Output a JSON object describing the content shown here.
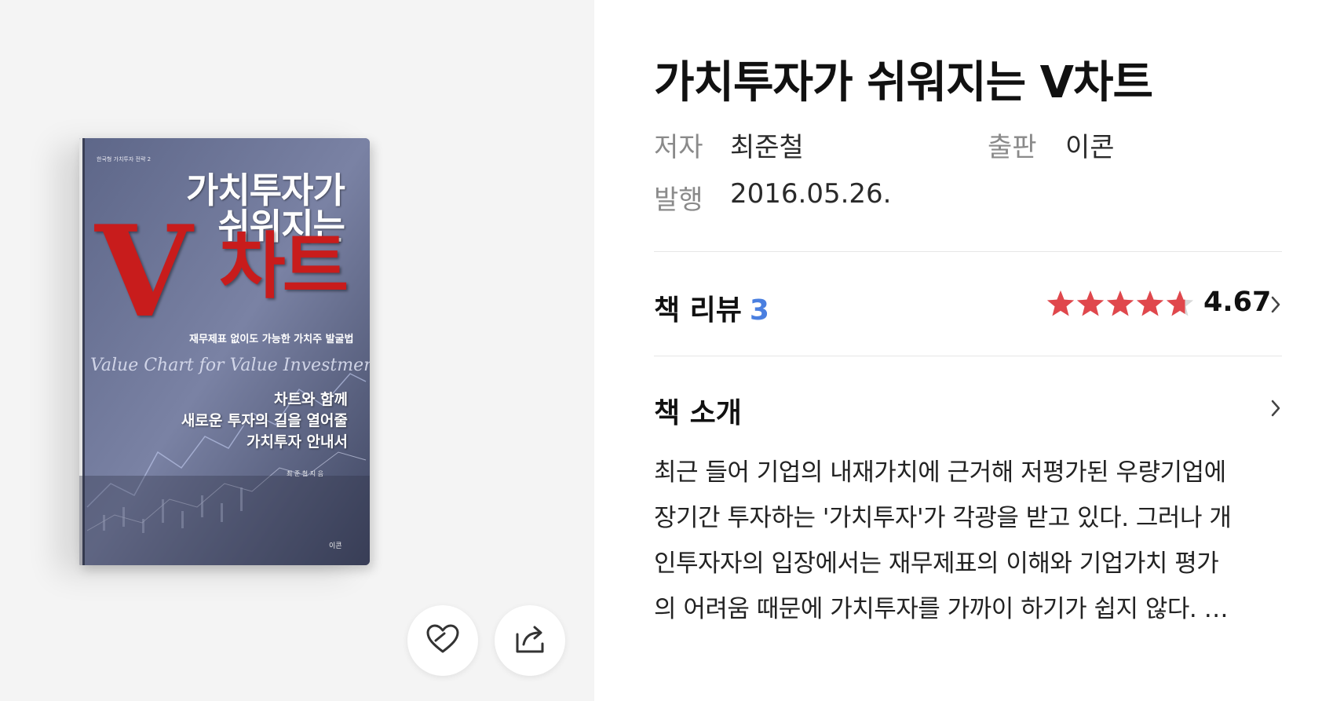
{
  "book": {
    "title": "가치투자가 쉬워지는 V차트",
    "meta": {
      "author_label": "저자",
      "author": "최준철",
      "publisher_label": "출판",
      "publisher": "이콘",
      "published_label": "발행",
      "published": "2016.05.26."
    }
  },
  "cover": {
    "series": "한국형 가치투자 전략 2",
    "title_line1": "가치투자가",
    "title_line2": "쉬워지는",
    "title_v": "V",
    "title_chart": "차트",
    "subtitle": "재무제표 없이도 가능한 가치주 발굴법",
    "english": "Value Chart for Value Investment",
    "tagline": [
      "차트와 함께",
      "새로운 투자의 길을 열어줄",
      "가치투자 안내서"
    ],
    "author_credit": "최 준 철  지 음",
    "publisher": "이콘"
  },
  "actions": {
    "like_icon": "heart-icon",
    "share_icon": "share-icon"
  },
  "review": {
    "heading": "책 리뷰",
    "count": "3",
    "rating": "4.67",
    "rating_fraction": 0.934,
    "star_color": "#e0474c"
  },
  "intro": {
    "heading": "책 소개",
    "lines": [
      "최근 들어 기업의 내재가치에 근거해 저평가된 우량기업에",
      "장기간 투자하는 '가치투자'가 각광을 받고 있다. 그러나 개",
      "인투자자의 입장에서는 재무제표의 이해와 기업가치 평가",
      "의 어려움 때문에 가치투자를 가까이 하기가 쉽지 않다. …"
    ]
  }
}
